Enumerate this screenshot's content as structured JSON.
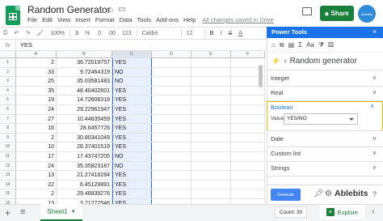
{
  "doc": {
    "title": "Random Generator",
    "menus": [
      "File",
      "Edit",
      "View",
      "Insert",
      "Format",
      "Data",
      "Tools",
      "Add-ons",
      "Help"
    ],
    "saved_status": "All changes saved in Drive"
  },
  "header": {
    "share_label": "Share",
    "avatar_text": "Ablebits"
  },
  "toolbar": {
    "zoom": "100%",
    "currency": "$",
    "percent": "%",
    "dec_decrease": ".0",
    "dec_increase": ".00",
    "more_formats": "123",
    "font": "Calibri",
    "font_size": "12",
    "bold": "B",
    "italic": "I",
    "strike": "S",
    "text_color": "A"
  },
  "formula_bar": {
    "fx": "fx",
    "value": "YES"
  },
  "grid": {
    "columns": [
      "A",
      "B",
      "C",
      "D",
      "E",
      "F"
    ],
    "rows": [
      {
        "n": "1",
        "a": "2",
        "b": "36.72019757",
        "c": "YES"
      },
      {
        "n": "2",
        "a": "33",
        "b": "9.72464319",
        "c": "NO"
      },
      {
        "n": "3",
        "a": "25",
        "b": "35.03581483",
        "c": "NO"
      },
      {
        "n": "4",
        "a": "35",
        "b": "48.40402601",
        "c": "YES"
      },
      {
        "n": "5",
        "a": "19",
        "b": "14.72608318",
        "c": "YES"
      },
      {
        "n": "6",
        "a": "24",
        "b": "29.22961947",
        "c": "YES"
      },
      {
        "n": "7",
        "a": "27",
        "b": "10.44835459",
        "c": "YES"
      },
      {
        "n": "8",
        "a": "16",
        "b": "28.6457726",
        "c": "YES"
      },
      {
        "n": "9",
        "a": "2",
        "b": "30.80341049",
        "c": "YES"
      },
      {
        "n": "10",
        "a": "10",
        "b": "28.37401519",
        "c": "YES"
      },
      {
        "n": "11",
        "a": "17",
        "b": "17.43747205",
        "c": "NO"
      },
      {
        "n": "12",
        "a": "24",
        "b": "35.35823187",
        "c": "NO"
      },
      {
        "n": "13",
        "a": "13",
        "b": "21.27418284",
        "c": "YES"
      },
      {
        "n": "14",
        "a": "22",
        "b": "6.45129891",
        "c": "YES"
      },
      {
        "n": "15",
        "a": "2",
        "b": "29.48839276",
        "c": "YES"
      },
      {
        "n": "16",
        "a": "13",
        "b": "3.71272546",
        "c": "YES"
      }
    ]
  },
  "sheet_bar": {
    "add": "+",
    "all": "≡",
    "tab_label": "Sheet1",
    "count": "Count: 30",
    "explore": "Explore"
  },
  "panel": {
    "title": "Power Tools",
    "close": "×",
    "section_title": "Random generator",
    "sections": [
      "Integer",
      "Real",
      "Boolean",
      "Date",
      "Custom list",
      "Strings"
    ],
    "boolean_value_label": "Value:",
    "boolean_value": "YES/NO",
    "generate_label": "Generate",
    "brand": "Ablebits",
    "help": "?"
  },
  "colors": {
    "accent_green": "#188038",
    "panel_blue": "#1a73e8",
    "selection_fill": "#e8f0fe"
  }
}
